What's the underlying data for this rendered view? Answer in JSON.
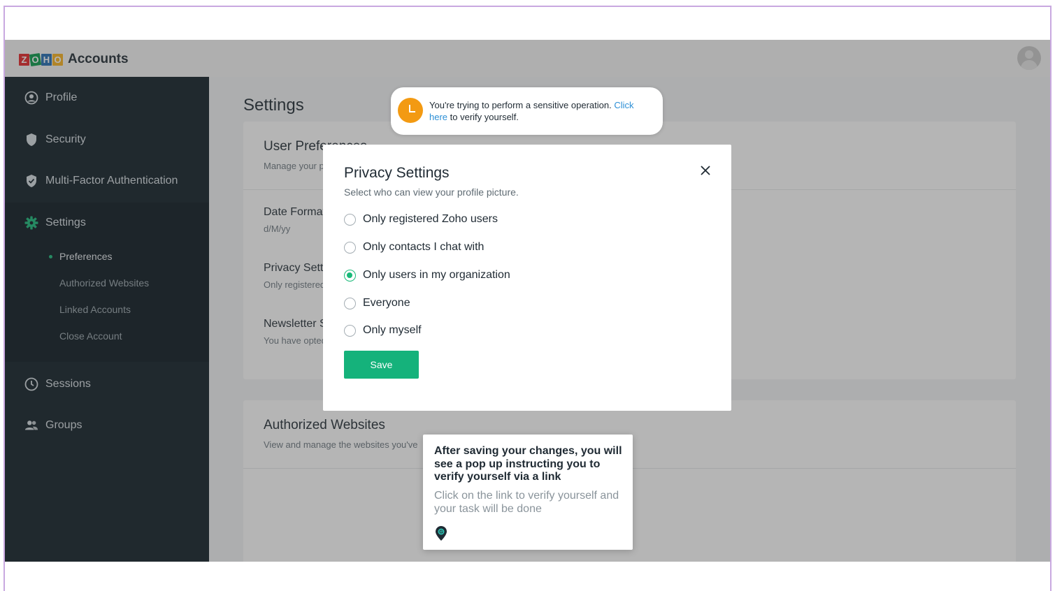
{
  "header": {
    "brand_letters": [
      "Z",
      "O",
      "H",
      "O"
    ],
    "app_title": "Accounts"
  },
  "sidebar": {
    "items": [
      {
        "label": "Profile",
        "icon": "user-circle-icon"
      },
      {
        "label": "Security",
        "icon": "shield-icon"
      },
      {
        "label": "Multi-Factor Authentication",
        "icon": "shield-check-icon"
      },
      {
        "label": "Settings",
        "icon": "gear-icon"
      },
      {
        "label": "Sessions",
        "icon": "clock-icon"
      },
      {
        "label": "Groups",
        "icon": "users-icon"
      }
    ],
    "settings_subitems": [
      "Preferences",
      "Authorized Websites",
      "Linked Accounts",
      "Close Account"
    ],
    "active_subitem": "Preferences"
  },
  "main": {
    "page_title": "Settings",
    "user_preferences": {
      "title": "User Preferences",
      "subtitle": "Manage your preferences",
      "rows": [
        {
          "title": "Date Format",
          "value": "d/M/yy"
        },
        {
          "title": "Privacy Settings",
          "value": "Only registered Zoho users"
        },
        {
          "title": "Newsletter Subscription",
          "value": "You have opted"
        }
      ]
    },
    "authorized_websites": {
      "title": "Authorized Websites",
      "subtitle": "View and manage the websites you've"
    }
  },
  "toast": {
    "text_before": "You're trying to perform a sensitive operation.",
    "link_text": "Click here",
    "text_after": "to verify yourself.",
    "icon": "clock-icon",
    "color": "#f39a12"
  },
  "modal": {
    "title": "Privacy Settings",
    "subtitle": "Select who can view your profile picture.",
    "options": [
      "Only registered Zoho users",
      "Only contacts I chat with",
      "Only users in my organization",
      "Everyone",
      "Only myself"
    ],
    "selected": "Only users in my organization",
    "save_label": "Save",
    "accent_color": "#15b27b"
  },
  "guide": {
    "title": "After saving your changes, you will see a pop up instructing you to verify yourself via a link",
    "body": "Click on the link to verify yourself and your task will be done",
    "icon": "location-pin-icon"
  }
}
